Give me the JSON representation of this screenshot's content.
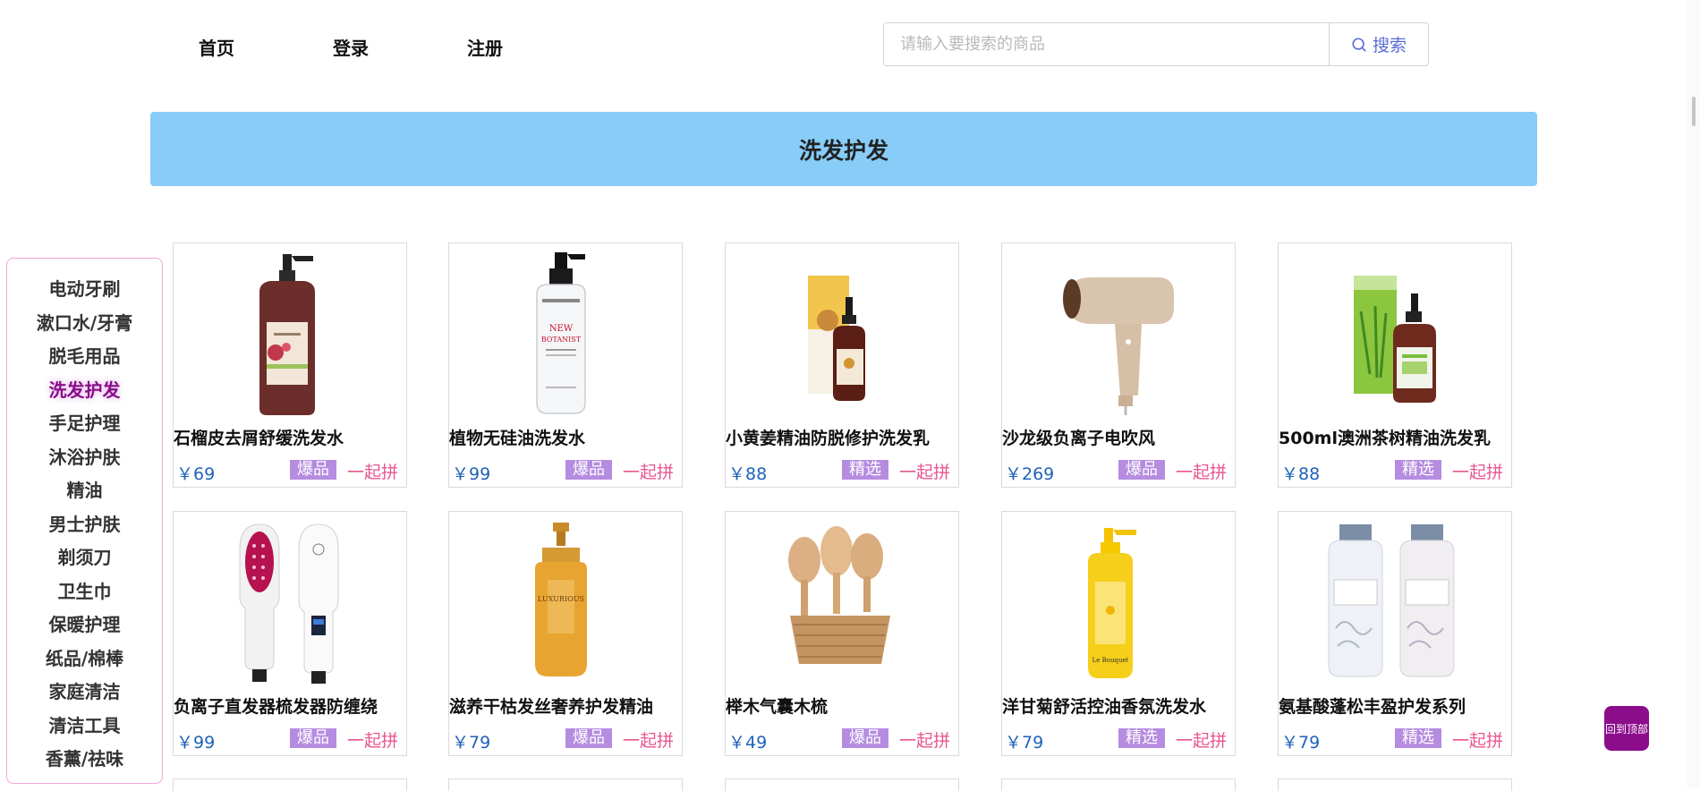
{
  "nav": {
    "home": "首页",
    "login": "登录",
    "register": "注册"
  },
  "search": {
    "placeholder": "请输入要搜索的商品",
    "button_label": "搜索"
  },
  "banner": {
    "title": "洗发护发"
  },
  "sidebar": {
    "active_index": 3,
    "items": [
      {
        "label": "电动牙刷"
      },
      {
        "label": "漱口水/牙膏"
      },
      {
        "label": "脱毛用品"
      },
      {
        "label": "洗发护发"
      },
      {
        "label": "手足护理"
      },
      {
        "label": "沐浴护肤"
      },
      {
        "label": "精油"
      },
      {
        "label": "男士护肤"
      },
      {
        "label": "剃须刀"
      },
      {
        "label": "卫生巾"
      },
      {
        "label": "保暖护理"
      },
      {
        "label": "纸品/棉棒"
      },
      {
        "label": "家庭清洁"
      },
      {
        "label": "清洁工具"
      },
      {
        "label": "香薰/祛味"
      }
    ]
  },
  "products": [
    {
      "name": "石榴皮去屑舒缓洗发水",
      "price": "￥69",
      "badge": "爆品",
      "group": "一起拼",
      "image": "pomegranate-shampoo-bottle"
    },
    {
      "name": "植物无硅油洗发水",
      "price": "￥99",
      "badge": "爆品",
      "group": "一起拼",
      "image": "clear-pump-shampoo-bottle"
    },
    {
      "name": "小黄姜精油防脱修护洗发乳",
      "price": "￥88",
      "badge": "精选",
      "group": "一起拼",
      "image": "ginger-shampoo-bottle-with-box"
    },
    {
      "name": "沙龙级负离子电吹风",
      "price": "￥269",
      "badge": "爆品",
      "group": "一起拼",
      "image": "hair-dryer"
    },
    {
      "name": "500ml澳洲茶树精油洗发乳",
      "price": "￥88",
      "badge": "精选",
      "group": "一起拼",
      "image": "tea-tree-shampoo-bottle-with-box"
    },
    {
      "name": "负离子直发器梳发器防缠绕",
      "price": "￥99",
      "badge": "爆品",
      "group": "一起拼",
      "image": "hair-straightener-brush"
    },
    {
      "name": "滋养干枯发丝奢养护发精油",
      "price": "￥79",
      "badge": "爆品",
      "group": "一起拼",
      "image": "hair-oil-bottle"
    },
    {
      "name": "榉木气囊木梳",
      "price": "￥49",
      "badge": "爆品",
      "group": "一起拼",
      "image": "wooden-combs-basket"
    },
    {
      "name": "洋甘菊舒活控油香氛洗发水",
      "price": "￥79",
      "badge": "精选",
      "group": "一起拼",
      "image": "yellow-chamomile-shampoo-bottle"
    },
    {
      "name": "氨基酸蓬松丰盈护发系列",
      "price": "￥79",
      "badge": "精选",
      "group": "一起拼",
      "image": "amino-acid-hair-care-bottles"
    }
  ],
  "back_to_top": "回到顶部",
  "colors": {
    "banner_bg": "#87cdf8",
    "price": "#1f62b8",
    "badge_bg": "#b58ce0",
    "group_text": "#e8558f",
    "active_category": "#8a0d8a",
    "back_to_top_bg": "#8c0d8c",
    "search_accent": "#5b6cd6"
  }
}
